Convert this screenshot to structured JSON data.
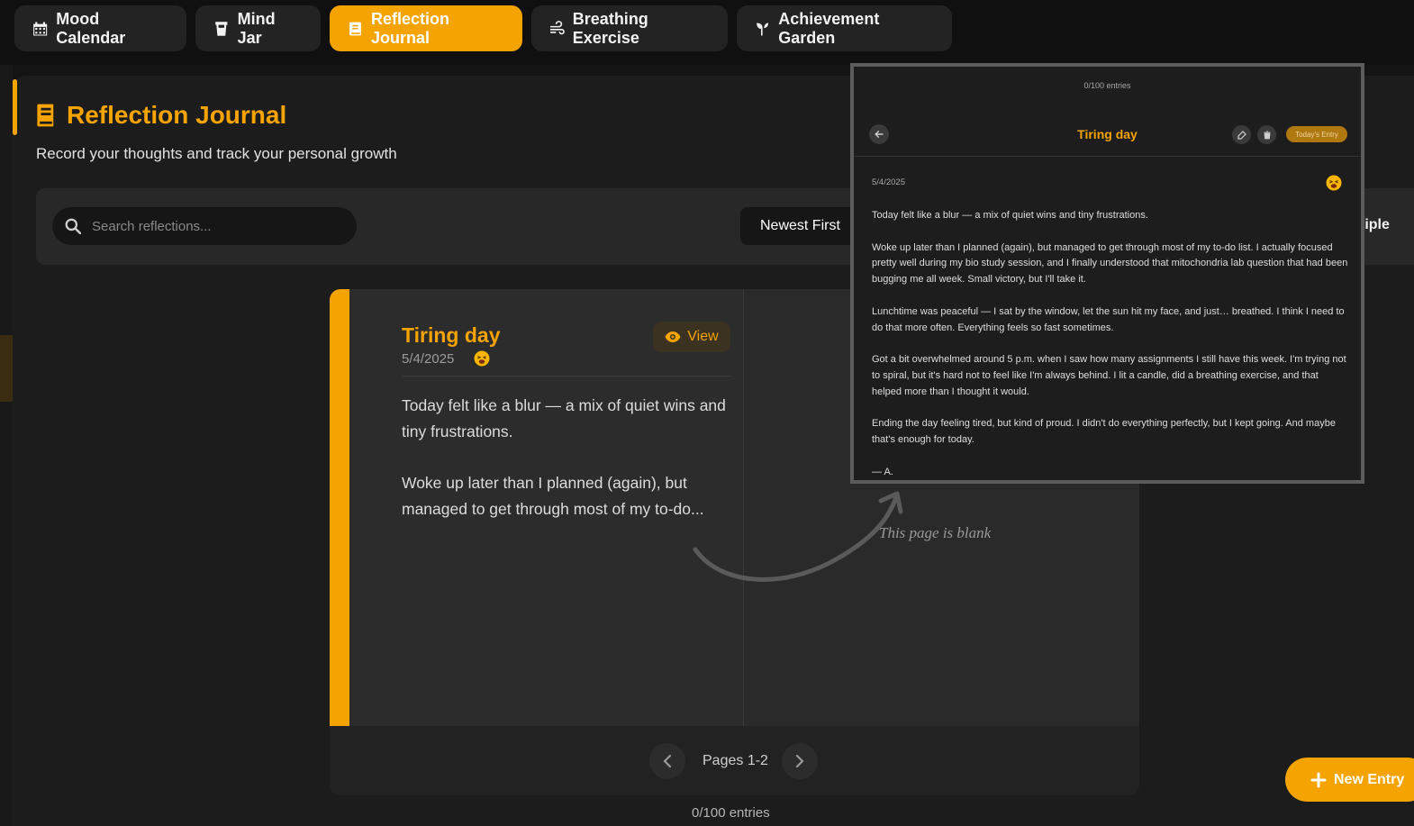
{
  "nav": {
    "tabs": [
      {
        "label": "Mood Calendar",
        "icon": "calendar-icon"
      },
      {
        "label": "Mind Jar",
        "icon": "jar-icon"
      },
      {
        "label": "Reflection Journal",
        "icon": "book-icon",
        "active": true
      },
      {
        "label": "Breathing Exercise",
        "icon": "wind-icon"
      },
      {
        "label": "Achievement Garden",
        "icon": "seedling-icon"
      }
    ]
  },
  "header": {
    "title": "Reflection Journal",
    "subtitle": "Record your thoughts and track your personal growth"
  },
  "toolbar": {
    "search_placeholder": "Search reflections...",
    "sort_value": "Newest First",
    "multiple_label": "tiple"
  },
  "entry": {
    "title": "Tiring day",
    "date": "5/4/2025",
    "mood": "tired-face-emoji",
    "view_label": "View",
    "preview": [
      "Today felt like a blur — a mix of quiet wins and tiny frustrations.",
      "Woke up later than I planned (again), but managed to get through most of my to-do..."
    ]
  },
  "right_page": {
    "blank_note": "This page is blank"
  },
  "pager": {
    "label": "Pages 1-2",
    "entries_count": "0/100 entries"
  },
  "new_entry_label": "New Entry",
  "zoom": {
    "entries_count": "0/100 entries",
    "title": "Tiring day",
    "badge": "Today's Entry",
    "date": "5/4/2025",
    "paragraphs": [
      "Today felt like a blur — a mix of quiet wins and tiny frustrations.",
      "Woke up later than I planned (again), but managed to get through most of my to-do list. I actually focused pretty well during my bio study session, and I finally understood that mitochondria lab question that had been bugging me all week. Small victory, but I'll take it.",
      "Lunchtime was peaceful — I sat by the window, let the sun hit my face, and just… breathed. I think I need to do that more often. Everything feels so fast sometimes.",
      "Got a bit overwhelmed around 5 p.m. when I saw how many assignments I still have this week. I'm trying not to spiral, but it's hard not to feel like I'm always behind. I lit a candle, did a breathing exercise, and that helped more than I thought it would.",
      "Ending the day feeling tired, but kind of proud. I didn't do everything perfectly, but I kept going. And maybe that's enough for today.",
      "— A."
    ]
  },
  "colors": {
    "accent": "#f5a300",
    "background": "#141414",
    "panel": "#1c1c1c"
  }
}
